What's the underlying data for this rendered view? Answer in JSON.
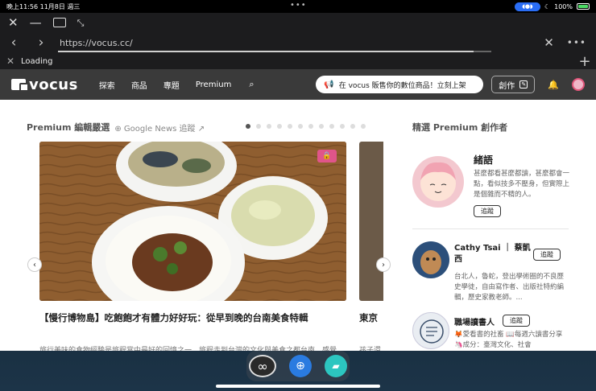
{
  "status": {
    "time": "晚上11:56",
    "date": "11月8日 週三",
    "battery": "100%"
  },
  "browser": {
    "url": "https://vocus.cc/",
    "tab_title": "Loading",
    "progress": 0.96
  },
  "site": {
    "logo": "vocus",
    "nav": [
      "探索",
      "商品",
      "專題",
      "Premium"
    ],
    "promo": "在 vocus 販售你的數位商品！立刻上架",
    "create": "創作"
  },
  "featured": {
    "title": "Premium 編輯嚴選",
    "gnews": "Google News 追蹤",
    "dots_count": 12,
    "active_dot": 0,
    "card1_title": "【慢行博物島】吃飽飽才有體力好好玩：從早到晚的台南美食特輯",
    "card1_desc": "旅行美味的食物經驗是旅程當中最好的回憶之一。旅程走到台灣的文化與美食之都台南，感覺",
    "card2_title": "東京",
    "card2_desc": "孩子還"
  },
  "creators": {
    "title": "精選 Premium 創作者",
    "follow_label": "追蹤",
    "items": [
      {
        "name": "緒語",
        "bio": "甚麼都看甚麼都讀，甚麼都會一點，看似技多不壓身，但實際上是個雜而不精的人。"
      },
      {
        "name": "Cathy Tsai ｜ 蔡凱西",
        "bio": "台北人，魯蛇，登出學術圈的不良歷史學徒，自由寫作者、出版社特約編輯，歷史家教老師。..."
      },
      {
        "name": "職場讀書人",
        "bio": "🦊愛看書的社畜 📖每週六讀書分享🦄成分：臺灣文化、社會"
      }
    ]
  },
  "colors": {
    "accent": "#e0558a",
    "header_bg": "#3a3a3a"
  }
}
